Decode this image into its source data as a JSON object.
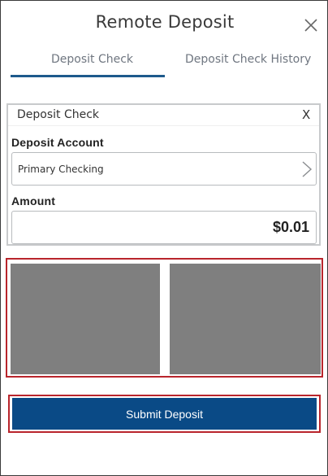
{
  "header": {
    "title": "Remote Deposit",
    "close_icon": "close-icon"
  },
  "tabs": [
    {
      "label": "Deposit Check",
      "active": true
    },
    {
      "label": "Deposit Check History",
      "active": false
    }
  ],
  "card": {
    "title": "Deposit Check",
    "close_label": "X",
    "account": {
      "label": "Deposit Account",
      "value": "Primary Checking",
      "icon": "chevron-right-icon"
    },
    "amount": {
      "label": "Amount",
      "value": "$0.01"
    }
  },
  "check_images": [
    {
      "side": "front"
    },
    {
      "side": "back"
    }
  ],
  "submit": {
    "label": "Submit Deposit"
  },
  "colors": {
    "accent": "#1e5a8c",
    "button": "#0a4a86",
    "highlight_border": "#b9252c",
    "image_placeholder": "#7f7f7f"
  }
}
